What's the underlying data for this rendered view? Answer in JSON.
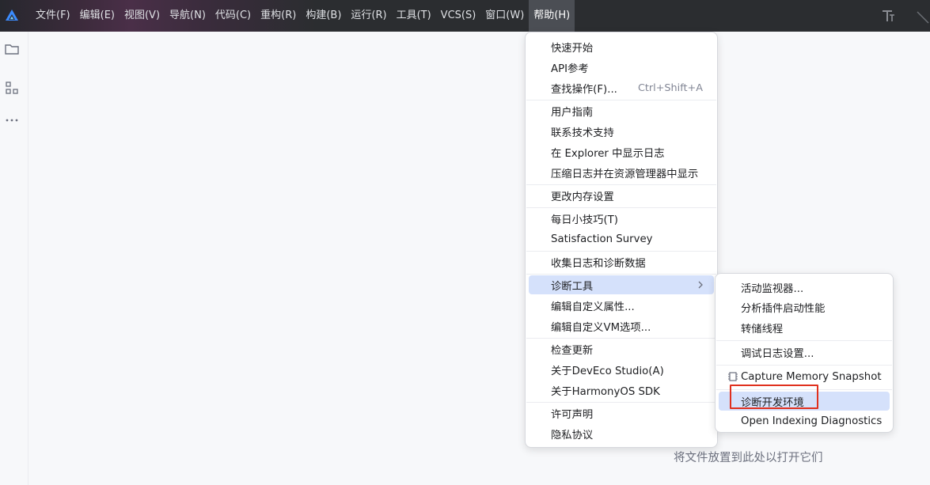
{
  "menubar": {
    "items": [
      "文件(F)",
      "编辑(E)",
      "视图(V)",
      "导航(N)",
      "代码(C)",
      "重构(R)",
      "构建(B)",
      "运行(R)",
      "工具(T)",
      "VCS(S)",
      "窗口(W)",
      "帮助(H)"
    ],
    "active": "帮助(H)"
  },
  "help_menu": {
    "groups": [
      [
        {
          "label": "快速开始"
        },
        {
          "label": "API参考"
        },
        {
          "label": "查找操作(F)...",
          "shortcut": "Ctrl+Shift+A"
        }
      ],
      [
        {
          "label": "用户指南"
        },
        {
          "label": "联系技术支持"
        },
        {
          "label": "在 Explorer 中显示日志"
        },
        {
          "label": "压缩日志并在资源管理器中显示"
        }
      ],
      [
        {
          "label": "更改内存设置"
        }
      ],
      [
        {
          "label": "每日小技巧(T)"
        },
        {
          "label": "Satisfaction Survey"
        }
      ],
      [
        {
          "label": "收集日志和诊断数据"
        }
      ],
      [
        {
          "label": "诊断工具",
          "submenu": true,
          "selected": true
        },
        {
          "label": "编辑自定义属性..."
        },
        {
          "label": "编辑自定义VM选项..."
        }
      ],
      [
        {
          "label": "检查更新"
        },
        {
          "label": "关于DevEco Studio(A)"
        },
        {
          "label": "关于HarmonyOS SDK"
        }
      ],
      [
        {
          "label": "许可声明"
        },
        {
          "label": "隐私协议"
        }
      ]
    ]
  },
  "diag_menu": {
    "groups": [
      [
        {
          "label": "活动监视器..."
        },
        {
          "label": "分析插件启动性能"
        },
        {
          "label": "转储线程"
        }
      ],
      [
        {
          "label": "调试日志设置..."
        }
      ],
      [
        {
          "label": "Capture Memory Snapshot",
          "icon": "memory-snapshot-icon"
        }
      ],
      [
        {
          "label": "诊断开发环境",
          "highlighted": true
        },
        {
          "label": "Open Indexing Diagnostics"
        }
      ]
    ]
  },
  "editor": {
    "drop_hint": "将文件放置到此处以打开它们"
  },
  "colors": {
    "highlight": "#d5e1fb",
    "annotation_box": "#e0301e",
    "topbar": "#2b2d30"
  },
  "icons": {
    "logo": "deveco-logo-icon",
    "toolstrip": [
      "folder-icon",
      "structure-icon",
      "more-icon"
    ],
    "titlebar": "text-style-icon"
  }
}
